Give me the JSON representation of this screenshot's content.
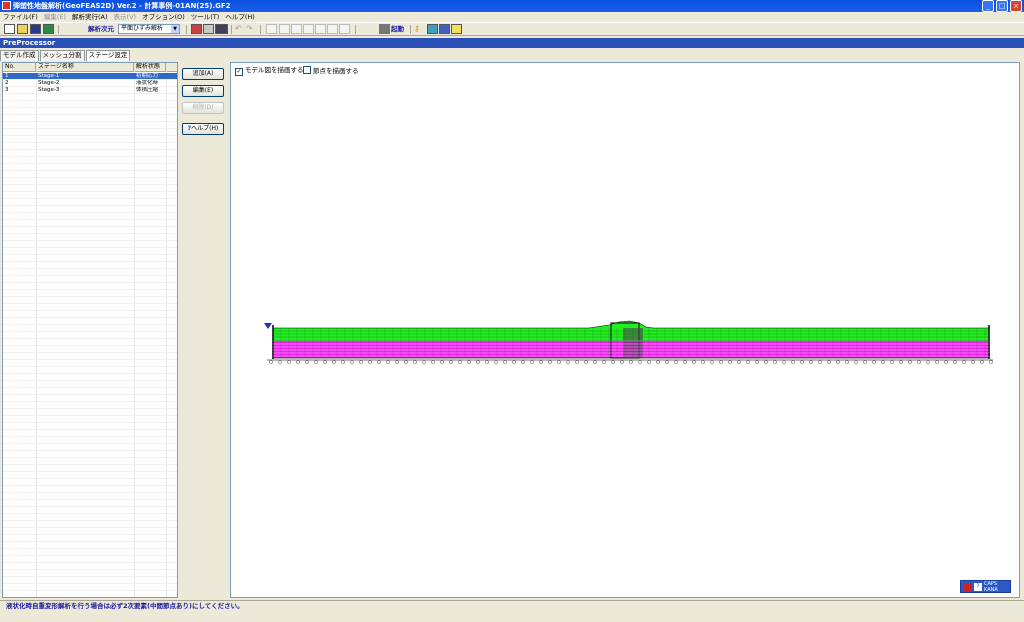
{
  "window": {
    "title": "弾塑性地盤解析(GeoFEAS2D) Ver.2 - 計算事例-01AN(25).GF2",
    "minimize": "_",
    "maximize": "□",
    "close": "×"
  },
  "menu": [
    {
      "label": "ファイル(F)",
      "enabled": true
    },
    {
      "label": "編集(E)",
      "enabled": false
    },
    {
      "label": "解析実行(A)",
      "enabled": true
    },
    {
      "label": "表示(V)",
      "enabled": false
    },
    {
      "label": "オプション(O)",
      "enabled": true
    },
    {
      "label": "ツール(T)",
      "enabled": true
    },
    {
      "label": "ヘルプ(H)",
      "enabled": true
    }
  ],
  "toolbar": {
    "dimension_label": "解析次元",
    "dimension_value": "平面ひずみ解析",
    "start_label": "起動"
  },
  "header": {
    "title": "PreProcessor"
  },
  "tabs": [
    {
      "label": "モデル作成",
      "active": false
    },
    {
      "label": "メッシュ分割",
      "active": false
    },
    {
      "label": "ステージ設定",
      "active": true
    }
  ],
  "stage_table": {
    "columns": [
      "No.",
      "ステージ名称",
      "解析状態"
    ],
    "rows": [
      {
        "no": "1",
        "name": "Stage-1",
        "state": "初期応力",
        "selected": true
      },
      {
        "no": "2",
        "name": "Stage-2",
        "state": "液状化時",
        "selected": false
      },
      {
        "no": "3",
        "name": "Stage-3",
        "state": "体積圧縮",
        "selected": false
      }
    ]
  },
  "buttons": {
    "add": "追加(A)",
    "edit": "編集(E)",
    "delete": "削除(D)",
    "help": "ヘルプ(H)"
  },
  "canvas_options": {
    "draw_model": {
      "label": "モデル図を描画する",
      "checked": true
    },
    "draw_nodes": {
      "label": "節点を描画する",
      "checked": false
    }
  },
  "status": {
    "message": "液状化時自重変形解析を行う場合は必ず2次要素(中間節点あり)にしてください。",
    "color": "#1a1aa0"
  },
  "ime": {
    "label1": "CAPS",
    "label2": "KANA"
  },
  "colors": {
    "title_bar": "#0a4fe0",
    "header_bar": "#2a50b8",
    "selection": "#316ac5",
    "soil_upper": "#22ee22",
    "soil_lower": "#ee22ee"
  }
}
